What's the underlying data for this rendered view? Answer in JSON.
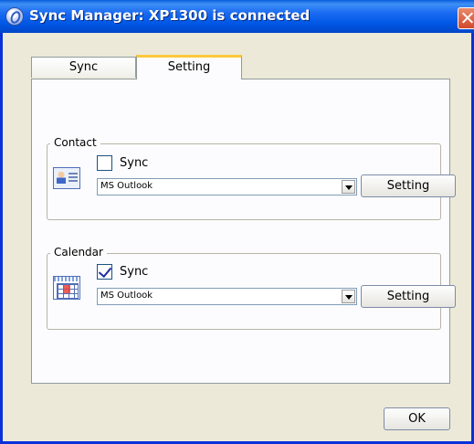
{
  "window": {
    "title": "Sync Manager: XP1300 is connected"
  },
  "tabs": [
    {
      "label": "Sync",
      "active": false
    },
    {
      "label": "Setting",
      "active": true
    }
  ],
  "contact": {
    "group_label": "Contact",
    "sync_label": "Sync",
    "sync_checked": false,
    "app_value": "MS Outlook",
    "setting_label": "Setting",
    "icon": "contact-card-icon"
  },
  "calendar": {
    "group_label": "Calendar",
    "sync_label": "Sync",
    "sync_checked": true,
    "app_value": "MS Outlook",
    "setting_label": "Setting",
    "icon": "calendar-icon"
  },
  "footer": {
    "ok_label": "OK"
  }
}
